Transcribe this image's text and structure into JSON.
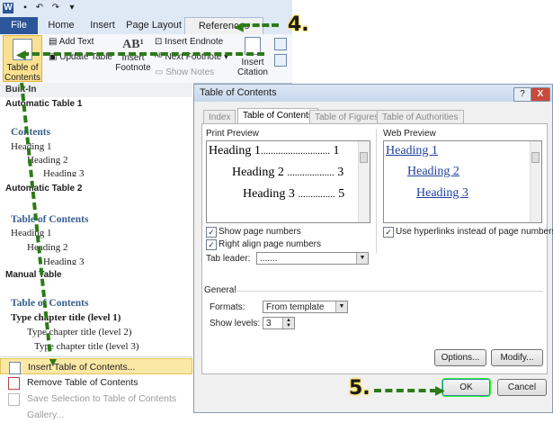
{
  "ribbon": {
    "tabs": [
      "File",
      "Home",
      "Insert",
      "Page Layout",
      "References"
    ],
    "toc_button": "Table of\nContents",
    "add_text": "Add Text",
    "update_table": "Update Table",
    "insert_footnote": "Insert\nFootnote",
    "footnote_glyph": "AB¹",
    "insert_endnote": "Insert Endnote",
    "next_footnote": "Next Footnote",
    "show_notes": "Show Notes",
    "insert_citation": "Insert\nCitation",
    "word_glyph": "W"
  },
  "gallery": {
    "section_header": "Built-In",
    "auto1": {
      "label": "Automatic Table 1",
      "title": "Contents",
      "h1": "Heading 1",
      "h2": "Heading 2",
      "h3": "Heading 3"
    },
    "auto2": {
      "label": "Automatic Table 2",
      "title": "Table of Contents",
      "h1": "Heading 1",
      "h2": "Heading 2",
      "h3": "Heading 3"
    },
    "manual": {
      "label": "Manual Table",
      "title": "Table of Contents",
      "l1": "Type chapter title (level 1)",
      "l2": "Type chapter title (level 2)",
      "l3": "Type chapter title (level 3)"
    },
    "menu": {
      "insert": "Insert Table of Contents...",
      "remove": "Remove Table of Contents",
      "save": "Save Selection to Table of Contents Gallery..."
    }
  },
  "dialog": {
    "title": "Table of Contents",
    "help": "?",
    "close": "X",
    "tabs": [
      "Index",
      "Table of Contents",
      "Table of Figures",
      "Table of Authorities"
    ],
    "print_preview_label": "Print Preview",
    "print_preview": [
      {
        "text": "Heading 1",
        "dots": "............................",
        "page": "1"
      },
      {
        "text": "Heading 2",
        "dots": "...................",
        "page": "3"
      },
      {
        "text": "Heading 3",
        "dots": "...............",
        "page": "5"
      }
    ],
    "web_preview_label": "Web Preview",
    "web_preview": [
      "Heading 1",
      "Heading 2",
      "Heading 3"
    ],
    "show_page_numbers": "Show page numbers",
    "right_align": "Right align page numbers",
    "tab_leader_label": "Tab leader:",
    "tab_leader_value": ".......",
    "use_hyperlinks": "Use hyperlinks instead of page numbers",
    "general_label": "General",
    "formats_label": "Formats:",
    "formats_value": "From template",
    "show_levels_label": "Show levels:",
    "show_levels_value": "3",
    "options_button": "Options...",
    "modify_button": "Modify...",
    "ok_button": "OK",
    "cancel_button": "Cancel"
  },
  "annotations": {
    "step4": "4.",
    "step5": "5."
  },
  "colors": {
    "accent": "#2b579a",
    "annotation_arrow": "#2d7a18",
    "annotation_halo": "#ffd400"
  }
}
